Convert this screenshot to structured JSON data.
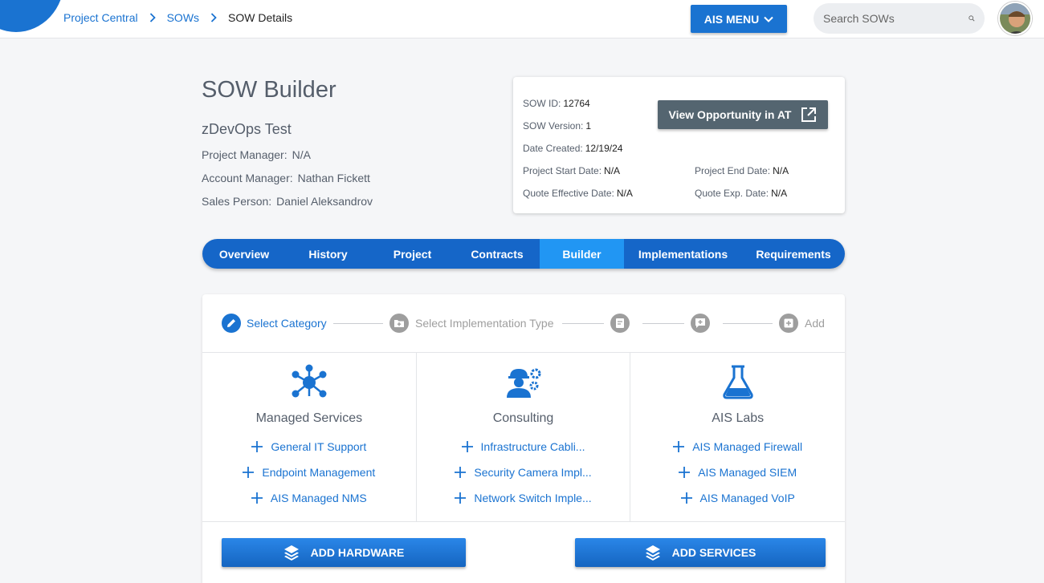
{
  "breadcrumb": {
    "items": [
      "Project Central",
      "SOWs"
    ],
    "current": "SOW Details"
  },
  "header": {
    "menu_label": "AIS MENU",
    "search_placeholder": "Search SOWs"
  },
  "page": {
    "title": "SOW Builder",
    "client": "zDevOps Test",
    "project_manager_label": "Project Manager:",
    "project_manager": "N/A",
    "account_manager_label": "Account Manager:",
    "account_manager": "Nathan Fickett",
    "sales_person_label": "Sales Person:",
    "sales_person": "Daniel Aleksandrov"
  },
  "info": {
    "sow_id_label": "SOW ID:",
    "sow_id": "12764",
    "sow_version_label": "SOW Version:",
    "sow_version": "1",
    "date_created_label": "Date Created:",
    "date_created": "12/19/24",
    "start_label": "Project Start Date:",
    "start": "N/A",
    "end_label": "Project End Date:",
    "end": "N/A",
    "quote_eff_label": "Quote Effective Date:",
    "quote_eff": "N/A",
    "quote_exp_label": "Quote Exp. Date:",
    "quote_exp": "N/A",
    "view_button": "View Opportunity in AT"
  },
  "tabs": [
    "Overview",
    "History",
    "Project",
    "Contracts",
    "Builder",
    "Implementations",
    "Requirements"
  ],
  "active_tab": "Builder",
  "stepper": {
    "step1": "Select Category",
    "step2": "Select Implementation Type",
    "step5": "Add"
  },
  "categories": [
    {
      "title": "Managed Services",
      "items": [
        "General IT Support",
        "Endpoint Management",
        "AIS Managed NMS"
      ]
    },
    {
      "title": "Consulting",
      "items": [
        "Infrastructure Cabli...",
        "Security Camera Impl...",
        "Network Switch Imple..."
      ]
    },
    {
      "title": "AIS Labs",
      "items": [
        "AIS Managed Firewall",
        "AIS Managed SIEM",
        "AIS Managed VoIP"
      ]
    }
  ],
  "buttons": {
    "add_hardware": "ADD HARDWARE",
    "add_services": "ADD SERVICES"
  },
  "colors": {
    "primary": "#1a73d1",
    "tab_bar": "#1566c8",
    "tab_active": "#2196f3",
    "muted": "#9e9e9e",
    "slate_button": "#546570"
  }
}
